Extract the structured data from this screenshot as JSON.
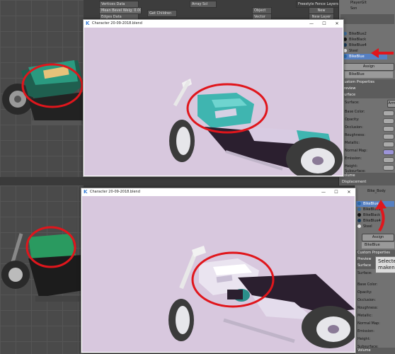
{
  "top_window": {
    "title": "Character 20-09-2018.blend",
    "controls": {
      "minimize": "—",
      "maximize": "☐",
      "close": "✕"
    }
  },
  "bottom_window": {
    "title": "Character 20-09-2018.blend",
    "controls": {
      "minimize": "—",
      "maximize": "☐",
      "close": "✕"
    }
  },
  "node_editor": {
    "vertices_label": "Vertices Data",
    "bevel_label": "Mean Bevel Weig: 0.00",
    "edges_label": "Edges Data",
    "add_layer": "New Layer",
    "new_button": "New",
    "freestyle": "Freestyle Fence Layers",
    "array_label": "Array Scl",
    "object_label": "Object",
    "flow_label": "Vector",
    "get_children": "Get Children"
  },
  "props_top": {
    "scene_items": [
      "PlayerGlt",
      "Son"
    ],
    "materials": [
      {
        "name": "BikeBlue2",
        "color": "#3a6a9a",
        "selected": false
      },
      {
        "name": "BikeBlack",
        "color": "#111111",
        "selected": false
      },
      {
        "name": "BikeBlue4",
        "color": "#1a3a5a",
        "selected": false
      },
      {
        "name": "Steel",
        "color": "#e8e8e8",
        "selected": false
      },
      {
        "name": "BikeBlue",
        "color": "#2a6aaa",
        "selected": true
      }
    ],
    "assign_button": "Assign",
    "material_name": "BikeBlue",
    "sections": {
      "custom_props": "Custom Properties",
      "preview": "Preview",
      "surface": "Surface",
      "volume": "Volume",
      "displacement": "Displacement"
    },
    "surface_label": "Surface:",
    "surface_value": "Armo",
    "inputs": [
      "Base Color:",
      "Opacity:",
      "Occlusion:",
      "Roughness:",
      "Metallic:",
      "Normal Map:",
      "Emission:",
      "Height:",
      "Subsurface:"
    ]
  },
  "props_bottom": {
    "object_name": "Bike_Body",
    "materials": [
      {
        "name": "BikeBlue",
        "color": "#2a6aaa",
        "selected": true
      },
      {
        "name": "BikeBlue2",
        "color": "#3a6a9a",
        "selected": false
      },
      {
        "name": "BikeBlack",
        "color": "#111111",
        "selected": false
      },
      {
        "name": "BikeBlue4",
        "color": "#1a3a5a",
        "selected": false
      },
      {
        "name": "Steel",
        "color": "#e8e8e8",
        "selected": false
      }
    ],
    "assign_button": "Assign",
    "material_name": "BikeBlue",
    "sections": {
      "custom_props": "Custom Properties",
      "preview": "Preview",
      "surface": "Surface",
      "volume": "Volume"
    },
    "surface_label": "Surface:",
    "inputs": [
      "Base Color:",
      "Opacity:",
      "Occlusion:",
      "Roughness:",
      "Metallic:",
      "Normal Map:",
      "Emission:",
      "Height:",
      "Subsurface:"
    ],
    "callout_lines": [
      "Selecte",
      "maken"
    ]
  },
  "colors": {
    "annotation": "#e0161c",
    "canvas": "#d8c8de",
    "teal": "#3fb5b0",
    "selection": "#5680c2"
  }
}
